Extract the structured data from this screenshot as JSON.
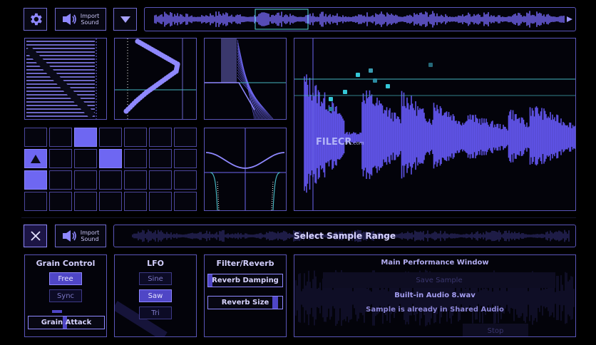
{
  "toolbar": {
    "import_label_line1": "Import",
    "import_label_line2": "Sound"
  },
  "sample_bar": {
    "import_label_line1": "Import",
    "import_label_line2": "Sound",
    "select_range_label": "Select Sample Range"
  },
  "watermark": {
    "brand": "FILECR",
    "suffix": ".com"
  },
  "grain_control": {
    "title": "Grain Control",
    "options": [
      "Free",
      "Sync"
    ],
    "selected": "Free",
    "attack_label": "Grain Attack"
  },
  "lfo": {
    "title": "LFO",
    "options": [
      "Sine",
      "Saw",
      "Tri"
    ],
    "selected": "Saw"
  },
  "filter_reverb": {
    "title": "Filter/Reverb",
    "reverb_damping_label": "Reverb Damping",
    "reverb_size_label": "Reverb Size",
    "reverb_damping_level": 0.05,
    "reverb_size_level": 0.9
  },
  "main_performance": {
    "title": "Main Performance Window",
    "save_button": "Save Sample",
    "filename": "Built-in Audio 8.wav",
    "status": "Sample is already in Shared Audio",
    "bottom_button": "Stop"
  },
  "pad_grid": {
    "rows": 4,
    "cols": 7,
    "active_cells": [
      [
        0,
        2
      ],
      [
        1,
        3
      ],
      [
        2,
        0
      ]
    ],
    "arrow_cell": [
      1,
      0
    ]
  },
  "colors": {
    "accent": "#6e67f2",
    "panel_border": "#5a55b8",
    "waveform": "#6a5cff",
    "cyan_marker": "#35c8d8"
  }
}
